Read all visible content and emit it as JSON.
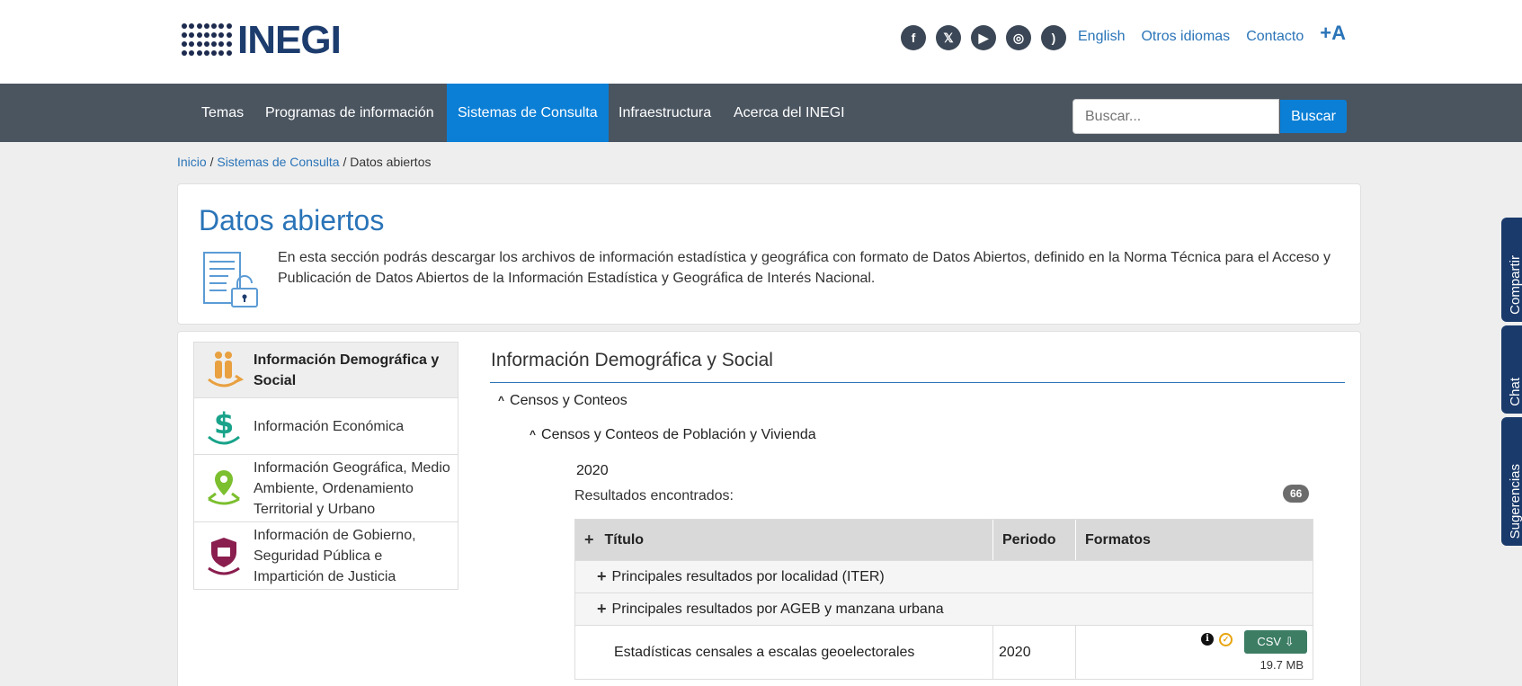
{
  "header": {
    "logo_text": "INEGI",
    "social": [
      "facebook-icon",
      "x-icon",
      "youtube-icon",
      "instagram-icon",
      "rss-icon"
    ],
    "links": {
      "english": "English",
      "otros": "Otros idiomas",
      "contacto": "Contacto",
      "font_size": "+A"
    }
  },
  "nav": {
    "items": [
      "Temas",
      "Programas de información",
      "Sistemas de Consulta",
      "Infraestructura",
      "Acerca del INEGI"
    ],
    "active_index": 2,
    "search_placeholder": "Buscar...",
    "search_button": "Buscar"
  },
  "breadcrumb": {
    "inicio": "Inicio",
    "sistemas": "Sistemas de Consulta",
    "current": "Datos abiertos",
    "sep": "/"
  },
  "intro": {
    "title": "Datos abiertos",
    "text": "En esta sección podrás descargar los archivos de información estadística y geográfica con formato de Datos Abiertos, definido en la Norma Técnica para el Acceso y Publicación de Datos Abiertos de la Información Estadística y Geográfica de Interés Nacional."
  },
  "categories": [
    {
      "label": "Información Demográfica y Social",
      "icon": "people-icon",
      "active": true
    },
    {
      "label": "Información Económica",
      "icon": "dollar-icon",
      "active": false
    },
    {
      "label": "Información Geográfica, Medio Ambiente, Ordenamiento Territorial y Urbano",
      "icon": "location-pin-icon",
      "active": false
    },
    {
      "label": "Información de Gobierno, Seguridad Pública e Impartición de Justicia",
      "icon": "government-shield-icon",
      "active": false
    }
  ],
  "content": {
    "section_title": "Información Demográfica y Social",
    "tree_level1": "Censos y Conteos",
    "tree_level2": "Censos y Conteos de Población y Vivienda",
    "year": "2020",
    "results_label": "Resultados encontrados:",
    "results_count": "66",
    "table": {
      "headers": {
        "title": "Título",
        "period": "Periodo",
        "formats": "Formatos"
      },
      "groups": [
        "Principales resultados por localidad (ITER)",
        "Principales resultados por AGEB y manzana urbana"
      ],
      "rows": [
        {
          "title": "Estadísticas censales a escalas geoelectorales",
          "period": "2020",
          "format": "CSV",
          "size": "19.7 MB"
        }
      ]
    }
  },
  "side_tabs": [
    "Compartir",
    "Chat",
    "Sugerencias"
  ],
  "colors": {
    "nav_bg": "#4b5560",
    "accent": "#0b7fd6",
    "link": "#2a74b8",
    "csv": "#3c7d64"
  }
}
